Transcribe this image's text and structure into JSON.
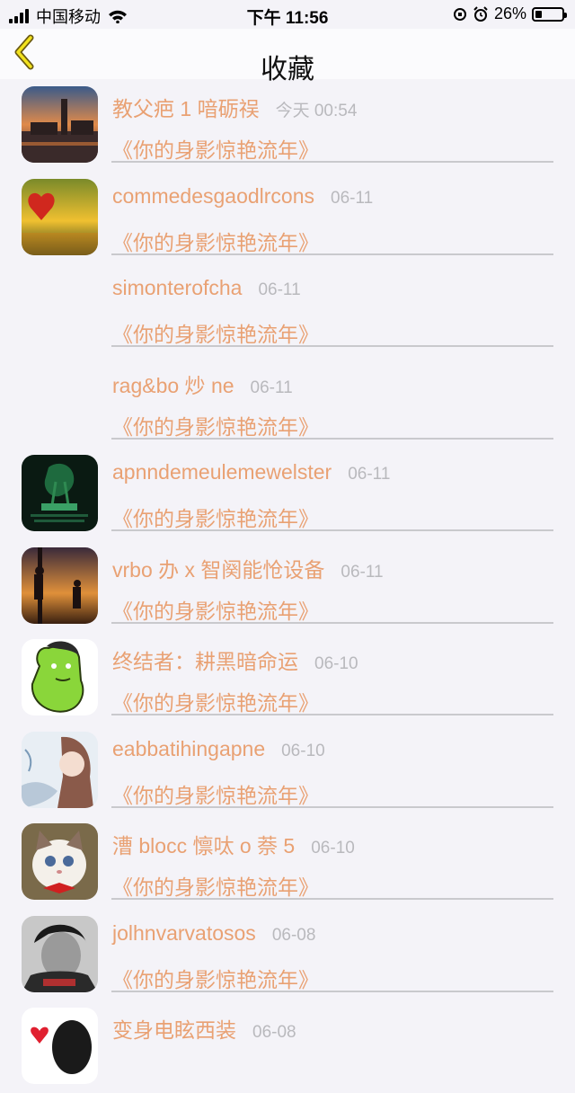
{
  "status_bar": {
    "carrier": "中国移动",
    "time": "下午 11:56",
    "battery_text": "26%",
    "battery_level": 0.26
  },
  "nav": {
    "title": "收藏",
    "back_icon": "chevron-left-icon"
  },
  "colors": {
    "accent": "#e9a173",
    "time_gray": "#b9b9bd",
    "background": "#f4f3f8"
  },
  "favorites": [
    {
      "user": "教父疤 1 喑砺祦",
      "time": "今天 00:54",
      "song": "《你的身影惊艳流年》",
      "avatar": "city-sunset"
    },
    {
      "user": "commedesgaodlrcons",
      "time": "06-11",
      "song": "《你的身影惊艳流年》",
      "avatar": "heart-sunset"
    },
    {
      "user": "simonterofcha",
      "time": "06-11",
      "song": "《你的身影惊艳流年》",
      "avatar": "none"
    },
    {
      "user": "rag&bo 炒 ne",
      "time": "06-11",
      "song": "《你的身影惊艳流年》",
      "avatar": "none"
    },
    {
      "user": "apnndemeulemewelster",
      "time": "06-11",
      "song": "《你的身影惊艳流年》",
      "avatar": "green-dark"
    },
    {
      "user": "vrbo 办 x 智阕能怆设备",
      "time": "06-11",
      "song": "《你的身影惊艳流年》",
      "avatar": "silhouette-sunset"
    },
    {
      "user": "终结者：耕黑暗命运",
      "time": "06-10",
      "song": "《你的身影惊艳流年》",
      "avatar": "green-hulk"
    },
    {
      "user": "eabbatihingapne",
      "time": "06-10",
      "song": "《你的身影惊艳流年》",
      "avatar": "girl-illustration"
    },
    {
      "user": "漕 blocc 懔呔 o 萘 5",
      "time": "06-10",
      "song": "《你的身影惊艳流年》",
      "avatar": "cat"
    },
    {
      "user": "jolhnvarvatosos",
      "time": "06-08",
      "song": "《你的身影惊艳流年》",
      "avatar": "bw-portrait"
    },
    {
      "user": "变身电眩西装",
      "time": "06-08",
      "song": "",
      "avatar": "heart-partial"
    }
  ]
}
